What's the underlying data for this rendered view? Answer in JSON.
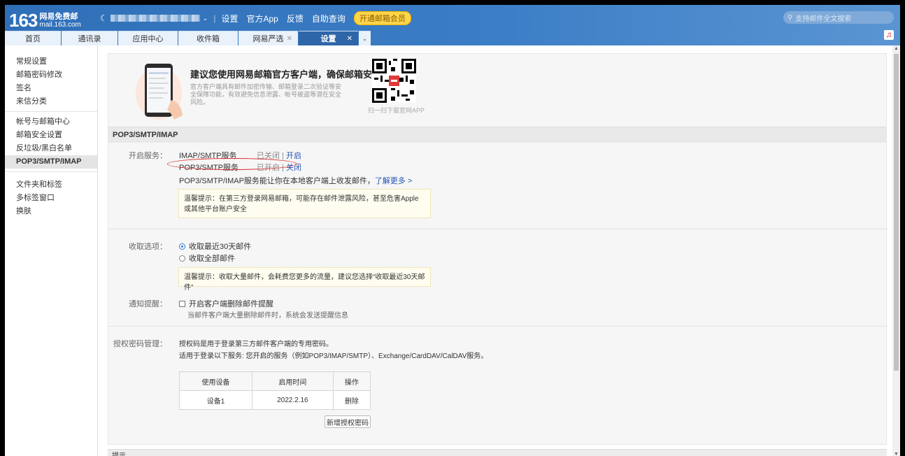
{
  "logo": {
    "number": "163",
    "line1": "网易免费邮",
    "line2": "mail.163.com"
  },
  "userbar": {
    "links": [
      "设置",
      "官方App",
      "反馈",
      "自助查询"
    ],
    "vip_button": "开通邮箱会员"
  },
  "search": {
    "placeholder": "支持邮件全文搜索"
  },
  "tabs": [
    {
      "label": "首页"
    },
    {
      "label": "通讯录"
    },
    {
      "label": "应用中心"
    },
    {
      "label": "收件箱"
    },
    {
      "label": "网易严选",
      "closable": true
    },
    {
      "label": "设置",
      "closable": true,
      "active": true
    }
  ],
  "sidebar": {
    "group1": [
      "常规设置",
      "邮箱密码修改",
      "签名",
      "来信分类"
    ],
    "group2": [
      "帐号与邮箱中心",
      "邮箱安全设置",
      "反垃圾/黑白名单",
      "POP3/SMTP/IMAP"
    ],
    "group3": [
      "文件夹和标签",
      "多标签窗口",
      "换肤"
    ],
    "active": "POP3/SMTP/IMAP"
  },
  "promo": {
    "title": "建议您使用网易邮箱官方客户端，确保邮箱安全",
    "desc": "官方客户端具有邮件加密传输、邮箱登录二次验证等安全保障功能，有效避免信息泄露、帐号被盗等潜在安全风险。",
    "qr_caption": "扫一扫下载官网APP"
  },
  "section_title": "POP3/SMTP/IMAP",
  "services": {
    "label": "开启服务：",
    "imap": {
      "name": "IMAP/SMTP服务",
      "status": "已关闭",
      "sep": " | ",
      "action": "开启"
    },
    "pop3": {
      "name": "POP3/SMTP服务",
      "status": "已开启",
      "sep": " | ",
      "action": "关闭"
    },
    "info": "POP3/SMTP/IMAP服务能让你在本地客户端上收发邮件，",
    "info_link": "了解更多 >",
    "tip": "温馨提示：在第三方登录网易邮箱，可能存在邮件泄露风险，甚至危害Apple或其他平台账户安全"
  },
  "receive": {
    "label": "收取选项：",
    "option1": "收取最近30天邮件",
    "option2": "收取全部邮件",
    "selected": "收取最近30天邮件",
    "tip": "温馨提示：收取大量邮件，会耗费您更多的流量，建议您选择“收取最近30天邮件”"
  },
  "notify": {
    "label": "通知提醒：",
    "checkbox": "开启客户端删除邮件提醒",
    "checked": false,
    "desc": "当邮件客户端大量删除邮件时，系统会发送提醒信息"
  },
  "auth": {
    "label": "授权密码管理：",
    "desc1": "授权码是用于登录第三方邮件客户端的专用密码。",
    "desc2": "适用于登录以下服务: 您开启的服务（例如POP3/IMAP/SMTP）、Exchange/CardDAV/CalDAV服务。",
    "headers": [
      "使用设备",
      "启用时间",
      "操作"
    ],
    "rows": [
      {
        "device": "设备1",
        "time": "2022.2.16",
        "action": "删除"
      }
    ],
    "add_button": "新增授权密码"
  },
  "next_section": "提示"
}
